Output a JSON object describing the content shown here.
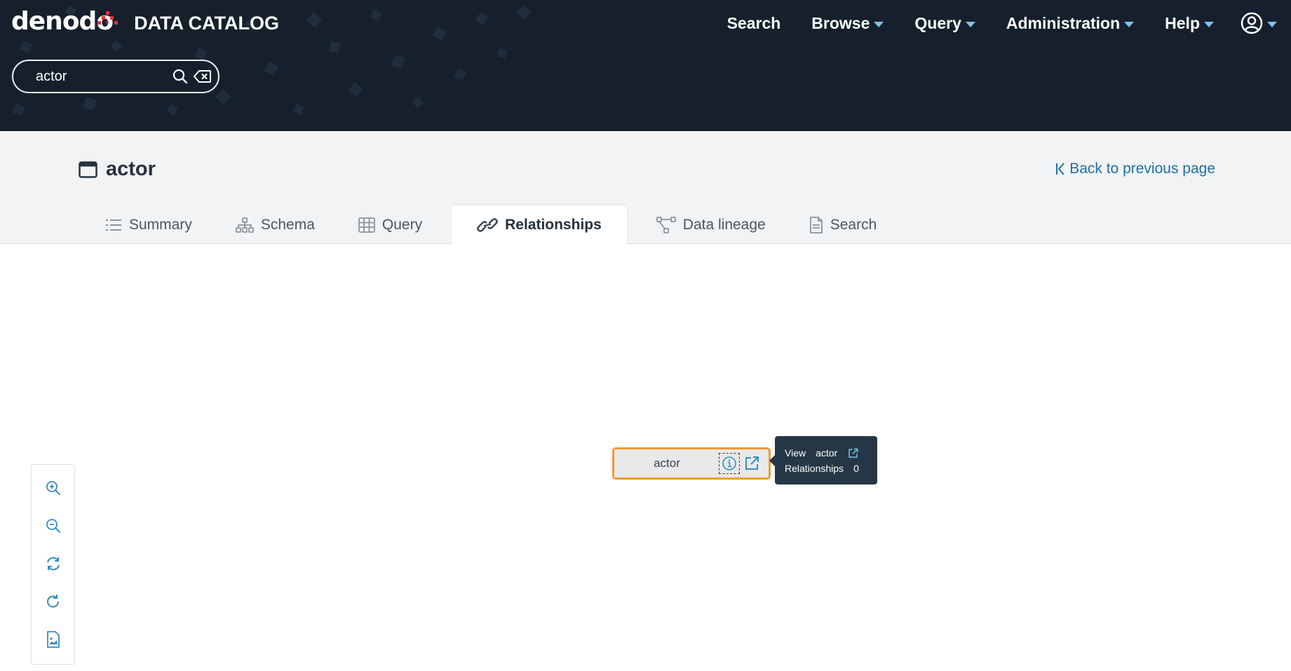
{
  "app": {
    "logo_text": "denodo",
    "product_name": "DATA CATALOG"
  },
  "nav": {
    "items": [
      {
        "label": "Search",
        "has_menu": false
      },
      {
        "label": "Browse",
        "has_menu": true
      },
      {
        "label": "Query",
        "has_menu": true
      },
      {
        "label": "Administration",
        "has_menu": true
      },
      {
        "label": "Help",
        "has_menu": true
      }
    ],
    "user_icon": "user-circle-icon"
  },
  "search": {
    "value": "actor",
    "search_icon": "search-icon",
    "clear_icon": "backspace-clear-icon"
  },
  "page": {
    "title": "actor",
    "title_icon": "view-window-icon",
    "back_label": "Back to previous page"
  },
  "tabs": [
    {
      "label": "Summary",
      "icon": "list-icon",
      "active": false
    },
    {
      "label": "Schema",
      "icon": "hierarchy-icon",
      "active": false
    },
    {
      "label": "Query",
      "icon": "table-grid-icon",
      "active": false
    },
    {
      "label": "Relationships",
      "icon": "link-icon",
      "active": true
    },
    {
      "label": "Data lineage",
      "icon": "lineage-icon",
      "active": false
    },
    {
      "label": "Search",
      "icon": "document-icon",
      "active": false
    }
  ],
  "graph": {
    "node": {
      "label": "actor",
      "info_icon": "info-icon",
      "open_icon": "external-link-icon"
    },
    "tooltip": {
      "view_key": "View",
      "view_value": "actor",
      "rel_key": "Relationships",
      "rel_value": "0"
    }
  },
  "zoom_controls": [
    {
      "name": "zoom-in-icon"
    },
    {
      "name": "zoom-out-icon"
    },
    {
      "name": "refresh-layout-icon"
    },
    {
      "name": "reset-icon"
    },
    {
      "name": "export-image-icon"
    }
  ],
  "colors": {
    "header_bg": "#15202c",
    "accent_blue": "#1f6fa3",
    "node_border": "#f39a35",
    "tooltip_bg": "#253746",
    "logo_red": "#e0323b"
  }
}
